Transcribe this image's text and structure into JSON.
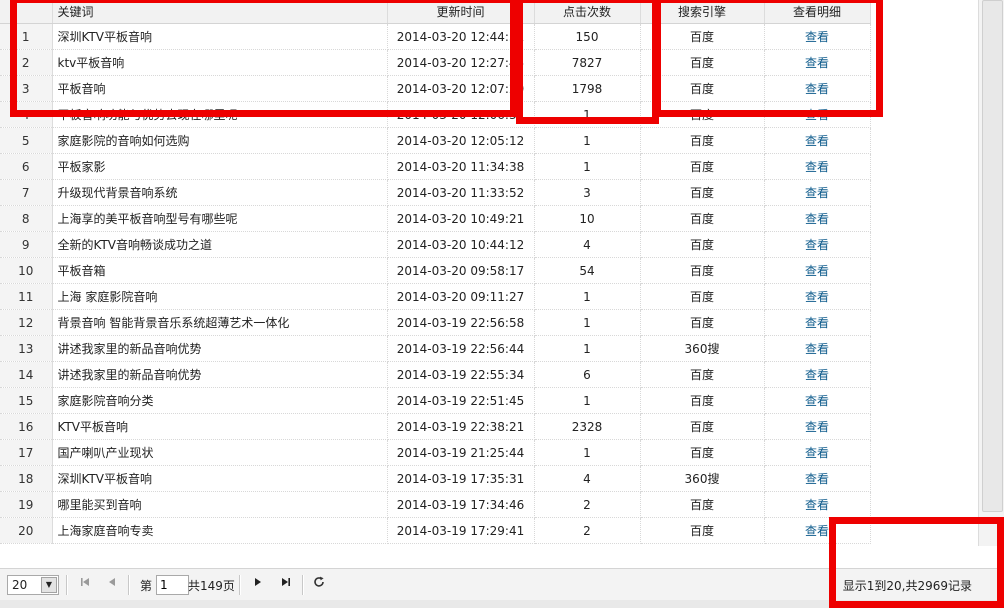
{
  "columns": {
    "keyword": "关键词",
    "updated": "更新时间",
    "clicks": "点击次数",
    "engine": "搜索引擎",
    "detail": "查看明细"
  },
  "rows": [
    {
      "n": "1",
      "keyword": "深圳KTV平板音响",
      "updated": "2014-03-20 12:44:31",
      "clicks": "150",
      "engine": "百度",
      "detail": "查看"
    },
    {
      "n": "2",
      "keyword": "ktv平板音响",
      "updated": "2014-03-20 12:27:45",
      "clicks": "7827",
      "engine": "百度",
      "detail": "查看"
    },
    {
      "n": "3",
      "keyword": "平板音响",
      "updated": "2014-03-20 12:07:29",
      "clicks": "1798",
      "engine": "百度",
      "detail": "查看"
    },
    {
      "n": "4",
      "keyword": "平板音响功能与优势去现在哪里呢",
      "updated": "2014-03-20 12:06:32",
      "clicks": "1",
      "engine": "百度",
      "detail": "查看"
    },
    {
      "n": "5",
      "keyword": "家庭影院的音响如何选购",
      "updated": "2014-03-20 12:05:12",
      "clicks": "1",
      "engine": "百度",
      "detail": "查看"
    },
    {
      "n": "6",
      "keyword": "平板家影",
      "updated": "2014-03-20 11:34:38",
      "clicks": "1",
      "engine": "百度",
      "detail": "查看"
    },
    {
      "n": "7",
      "keyword": "升级现代背景音响系统",
      "updated": "2014-03-20 11:33:52",
      "clicks": "3",
      "engine": "百度",
      "detail": "查看"
    },
    {
      "n": "8",
      "keyword": "上海享的美平板音响型号有哪些呢",
      "updated": "2014-03-20 10:49:21",
      "clicks": "10",
      "engine": "百度",
      "detail": "查看"
    },
    {
      "n": "9",
      "keyword": "全新的KTV音响畅谈成功之道",
      "updated": "2014-03-20 10:44:12",
      "clicks": "4",
      "engine": "百度",
      "detail": "查看"
    },
    {
      "n": "10",
      "keyword": "平板音箱",
      "updated": "2014-03-20 09:58:17",
      "clicks": "54",
      "engine": "百度",
      "detail": "查看"
    },
    {
      "n": "11",
      "keyword": "上海 家庭影院音响",
      "updated": "2014-03-20 09:11:27",
      "clicks": "1",
      "engine": "百度",
      "detail": "查看"
    },
    {
      "n": "12",
      "keyword": "背景音响 智能背景音乐系统超薄艺术一体化",
      "updated": "2014-03-19 22:56:58",
      "clicks": "1",
      "engine": "百度",
      "detail": "查看"
    },
    {
      "n": "13",
      "keyword": "讲述我家里的新品音响优势",
      "updated": "2014-03-19 22:56:44",
      "clicks": "1",
      "engine": "360搜",
      "detail": "查看"
    },
    {
      "n": "14",
      "keyword": "讲述我家里的新品音响优势",
      "updated": "2014-03-19 22:55:34",
      "clicks": "6",
      "engine": "百度",
      "detail": "查看"
    },
    {
      "n": "15",
      "keyword": "家庭影院音响分类",
      "updated": "2014-03-19 22:51:45",
      "clicks": "1",
      "engine": "百度",
      "detail": "查看"
    },
    {
      "n": "16",
      "keyword": "KTV平板音响",
      "updated": "2014-03-19 22:38:21",
      "clicks": "2328",
      "engine": "百度",
      "detail": "查看"
    },
    {
      "n": "17",
      "keyword": "国产喇叭产业现状",
      "updated": "2014-03-19 21:25:44",
      "clicks": "1",
      "engine": "百度",
      "detail": "查看"
    },
    {
      "n": "18",
      "keyword": "深圳KTV平板音响",
      "updated": "2014-03-19 17:35:31",
      "clicks": "4",
      "engine": "360搜",
      "detail": "查看"
    },
    {
      "n": "19",
      "keyword": "哪里能买到音响",
      "updated": "2014-03-19 17:34:46",
      "clicks": "2",
      "engine": "百度",
      "detail": "查看"
    },
    {
      "n": "20",
      "keyword": "上海家庭音响专卖",
      "updated": "2014-03-19 17:29:41",
      "clicks": "2",
      "engine": "百度",
      "detail": "查看"
    }
  ],
  "pager": {
    "page_size": "20",
    "page_prefix": "第",
    "page_number": "1",
    "page_total": "共149页",
    "record_info": "显示1到20,共2969记录",
    "icons": {
      "first": "first-page-icon",
      "prev": "prev-page-icon",
      "next": "next-page-icon",
      "last": "last-page-icon",
      "refresh": "refresh-icon",
      "dropdown": "chevron-down-icon"
    }
  },
  "colors": {
    "link": "#0e5b8c",
    "highlight_box": "#ee0000",
    "header_bg": "#f2f2f2"
  }
}
